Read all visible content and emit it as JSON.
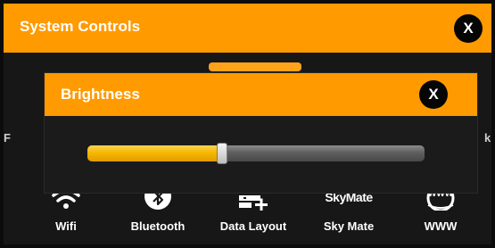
{
  "panel": {
    "title": "System Controls",
    "close_label": "X",
    "left_edge_char": "F",
    "right_edge_char": "k"
  },
  "dialog": {
    "title": "Brightness",
    "close_label": "X",
    "brightness_level": 0.4
  },
  "toolbar": {
    "items": [
      {
        "label": "Wifi",
        "icon": "wifi-icon"
      },
      {
        "label": "Bluetooth",
        "icon": "bluetooth-icon"
      },
      {
        "label": "Data Layout",
        "icon": "data-layout-icon"
      },
      {
        "label": "Sky Mate",
        "icon": "skymate-icon",
        "icon_text": "SkyMate"
      },
      {
        "label": "WWW",
        "icon": "www-globe-icon",
        "icon_text": "WWW"
      }
    ]
  },
  "colors": {
    "accent": "#ff9a00",
    "background": "#171717",
    "slider_fill": "#f5b800"
  }
}
